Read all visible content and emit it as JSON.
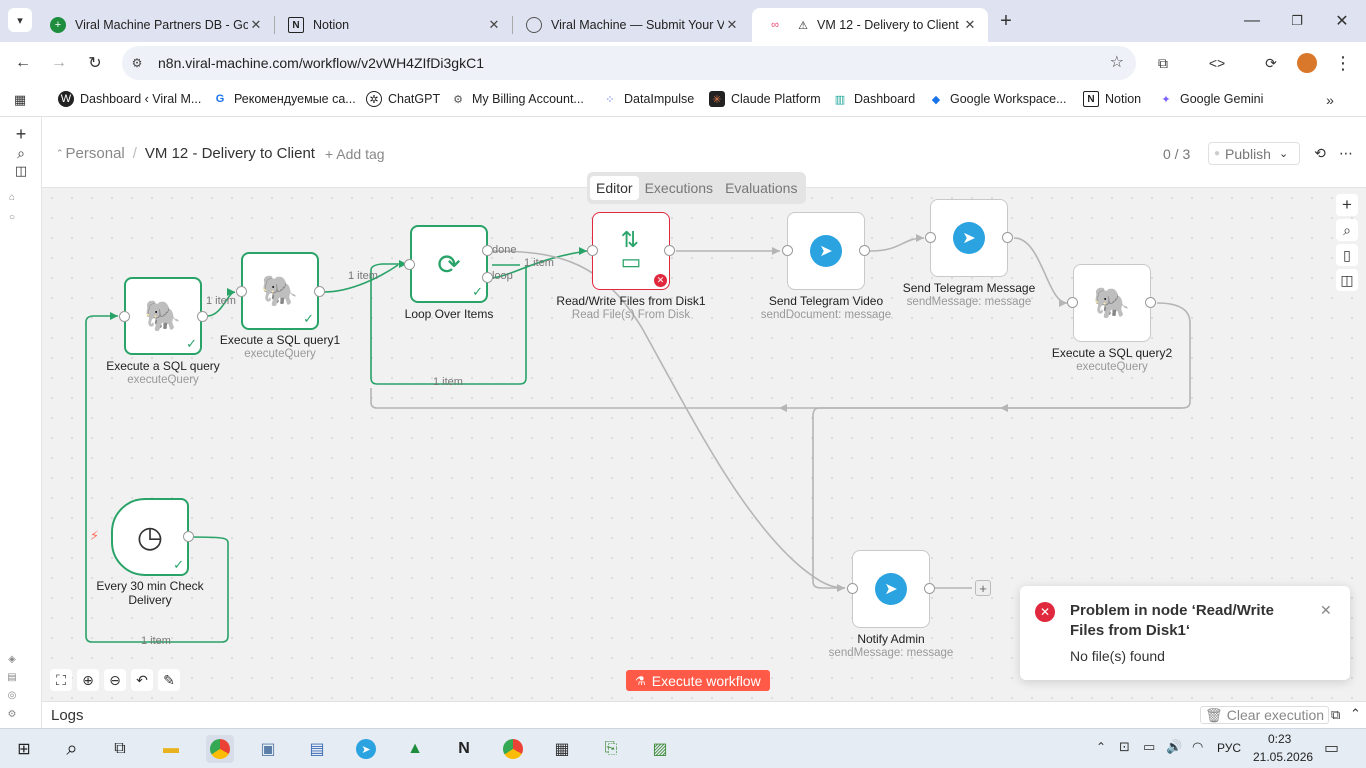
{
  "tabs": [
    {
      "title": "Viral Machine Partners DB - Goo",
      "icon": "sheets-icon"
    },
    {
      "title": "Notion",
      "icon": "notion-icon"
    },
    {
      "title": "Viral Machine — Submit Your V",
      "icon": "globe-icon"
    },
    {
      "title": "VM 12 - Delivery to Client -",
      "icon": "n8n-icon"
    }
  ],
  "url": "n8n.viral-machine.com/workflow/v2vWH4ZIfDi3gkC1",
  "bookmarks": [
    "Dashboard ‹ Viral M...",
    "Рекомендуемые са...",
    "ChatGPT",
    "My Billing Account...",
    "DataImpulse",
    "Claude Platform",
    "Dashboard",
    "Google Workspace...",
    "Notion",
    "Google Gemini"
  ],
  "header": {
    "breadcrumb_parent": "Personal",
    "separator": "/",
    "workflow_name": "VM 12 - Delivery to Client",
    "add_tag": "+ Add tag",
    "counter": "0 / 3",
    "publish": "Publish"
  },
  "view_tabs": [
    "Editor",
    "Executions",
    "Evaluations"
  ],
  "nodes": {
    "sql1": {
      "title": "Execute a SQL query",
      "sub": "executeQuery"
    },
    "sql2": {
      "title": "Execute a SQL query1",
      "sub": "executeQuery"
    },
    "loop": {
      "title": "Loop Over Items"
    },
    "rw": {
      "title": "Read/Write Files from Disk1",
      "sub": "Read File(s) From Disk"
    },
    "tgvideo": {
      "title": "Send Telegram Video",
      "sub": "sendDocument: message"
    },
    "tgmsg": {
      "title": "Send Telegram Message",
      "sub": "sendMessage: message"
    },
    "sql3": {
      "title": "Execute a SQL query2",
      "sub": "executeQuery"
    },
    "cron": {
      "title": "Every 30 min Check",
      "title2": "Delivery"
    },
    "notify": {
      "title": "Notify Admin",
      "sub": "sendMessage: message"
    }
  },
  "edge_labels": {
    "e1": "1 item",
    "e2": "1 item",
    "e3": "1 item",
    "loop_back": "1 item",
    "cron_edge": "1 item",
    "done": "done",
    "loop": "loop"
  },
  "execute_button": "Execute workflow",
  "toast": {
    "title": "Problem in node ‘Read/Write Files from Disk1‘",
    "message": "No file(s) found"
  },
  "logs": {
    "label": "Logs",
    "clear": "Clear execution"
  },
  "taskbar": {
    "lang": "РУС",
    "time": "0:23",
    "date": "21.05.2026"
  },
  "colors": {
    "accent": "#ff6d5a",
    "success": "#29a368",
    "error": "#e0283e",
    "telegram": "#2aa3e0"
  }
}
